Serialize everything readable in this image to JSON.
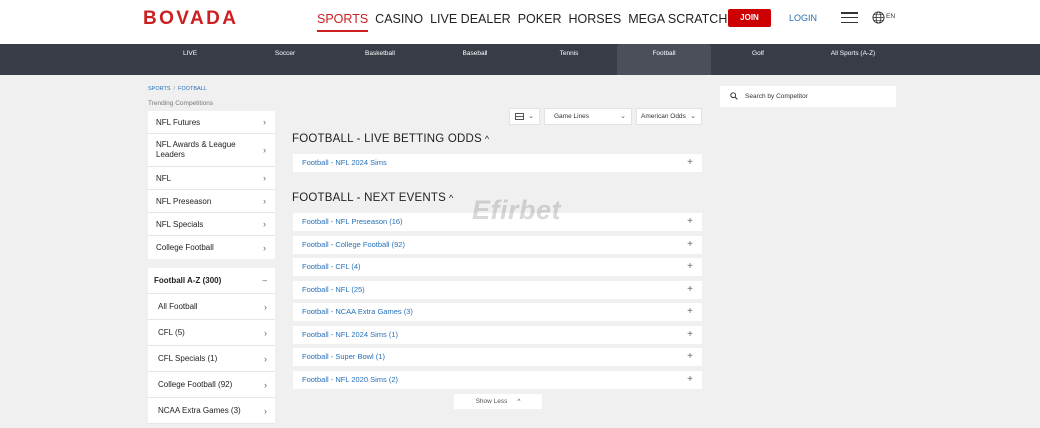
{
  "header": {
    "logo": "BOVADA",
    "nav": [
      {
        "label": "SPORTS",
        "active": true
      },
      {
        "label": "CASINO"
      },
      {
        "label": "LIVE DEALER"
      },
      {
        "label": "POKER"
      },
      {
        "label": "HORSES"
      },
      {
        "label": "MEGA SCRATCH CARD"
      }
    ],
    "join_label": "JOIN",
    "login_label": "LOGIN",
    "lang": "EN"
  },
  "sports_nav": [
    "LIVE",
    "Soccer",
    "Basketball",
    "Baseball",
    "Tennis",
    "Football",
    "Golf",
    "All Sports (A-Z)"
  ],
  "breadcrumb": {
    "root": "SPORTS",
    "sep": "/",
    "current": "FOOTBALL"
  },
  "sidebar": {
    "trending_label": "Trending Competitions",
    "trending": [
      "NFL Futures",
      "NFL Awards & League Leaders",
      "NFL",
      "NFL Preseason",
      "NFL Specials",
      "College Football"
    ],
    "az_label": "Football A-Z (300)",
    "az_items": [
      "All Football",
      "CFL (5)",
      "CFL Specials (1)",
      "College Football (92)",
      "NCAA Extra Games (3)"
    ]
  },
  "filters": {
    "market": "Game Lines",
    "odds": "American Odds"
  },
  "live_section": {
    "title": "FOOTBALL - LIVE BETTING ODDS",
    "events": [
      "Football - NFL 2024 Sims"
    ]
  },
  "next_section": {
    "title": "FOOTBALL - NEXT EVENTS",
    "events": [
      "Football - NFL Preseason (16)",
      "Football - College Football (92)",
      "Football - CFL (4)",
      "Football - NFL (25)",
      "Football - NCAA Extra Games (3)",
      "Football - NFL 2024 Sims (1)",
      "Football - Super Bowl (1)",
      "Football - NFL 2020 Sims (2)"
    ]
  },
  "show_less": "Show Less",
  "search": {
    "placeholder": "Search by Competitor"
  },
  "watermark": "Efirbet",
  "colors": {
    "brand": "#cc2020",
    "link": "#2770b8",
    "nav_bg": "#383c46"
  }
}
